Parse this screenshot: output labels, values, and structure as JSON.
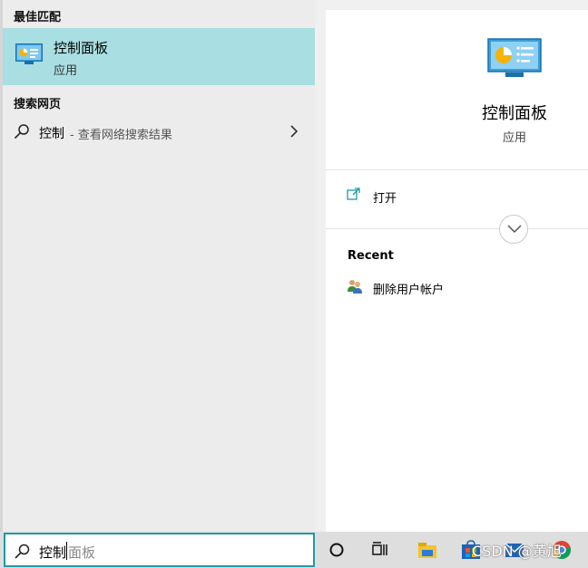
{
  "left": {
    "best_match_header": "最佳匹配",
    "best_match": {
      "title": "控制面板",
      "subtitle": "应用"
    },
    "web_header": "搜索网页",
    "web_item": {
      "query": "控制",
      "hint": "- 查看网络搜索结果"
    }
  },
  "detail": {
    "title": "控制面板",
    "subtitle": "应用",
    "open_label": "打开",
    "recent_header": "Recent",
    "recent_items": [
      {
        "label": "删除用户帐户",
        "icon": "users-icon"
      }
    ]
  },
  "taskbar": {
    "search_typed": "控制",
    "search_completion": "面板",
    "icons": [
      "cortana-icon",
      "task-view-icon",
      "file-explorer-icon",
      "store-icon",
      "mail-icon",
      "chrome-icon"
    ],
    "watermark": "CSDN @黄旭"
  },
  "colors": {
    "selected_bg": "#a9dfe2",
    "accent": "#1d9ba3",
    "panel_bg": "#ececec"
  }
}
